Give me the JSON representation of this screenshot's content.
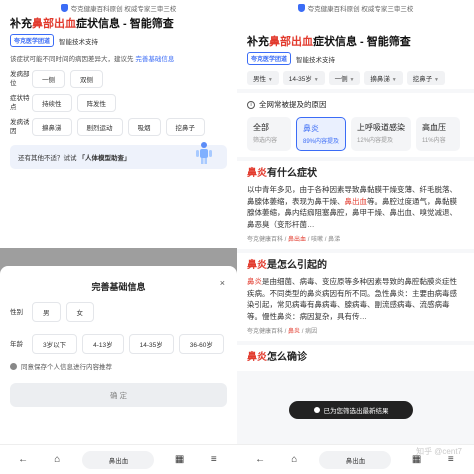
{
  "left": {
    "verify_text": "夸克健康百科原创 权威专家三审三校",
    "title_parts": [
      "补充",
      "鼻部出血",
      "症状信息 - 智能筛查"
    ],
    "brand_tag": "夸克医学团道",
    "brand_support": "智能技术支持",
    "hint_text": "该症状可能不同时间的病因差异大，建议先",
    "hint_link": "完善基础信息",
    "rows": [
      {
        "label": "发病部位",
        "options": [
          "一侧",
          "双侧"
        ]
      },
      {
        "label": "症状特点",
        "options": [
          "持续性",
          "阵发性"
        ]
      },
      {
        "label": "发病诱因",
        "options": [
          "擤鼻涕",
          "剧烈运动",
          "吸烟",
          "挖鼻子"
        ]
      }
    ],
    "ai_text": "还有其他不适？试试",
    "ai_cmd": "「人体模型助查」",
    "sheet": {
      "title": "完善基础信息",
      "close": "×",
      "gender_label": "性别",
      "gender_options": [
        "男",
        "女"
      ],
      "age_label": "年龄",
      "age_options": [
        "3岁以下",
        "4-13岁",
        "14-35岁",
        "36-60岁"
      ],
      "consent": "同意保存个人信息进行内容推荐",
      "confirm": "确 定"
    },
    "bottom": {
      "search": "鼻出血"
    }
  },
  "right": {
    "verify_text": "夸克健康百科原创 权威专家三审三校",
    "title_parts": [
      "补充",
      "鼻部出血",
      "症状信息 - 智能筛查"
    ],
    "brand_tag": "夸克医学团道",
    "brand_support": "智能技术支持",
    "filters": [
      "男性",
      "14-35岁",
      "一侧",
      "擤鼻涕",
      "挖鼻子"
    ],
    "causes_title": "全网常被提及的原因",
    "causes": [
      {
        "name": "全部",
        "pct": "筛选内容"
      },
      {
        "name": "鼻炎",
        "pct": "89%内容提及"
      },
      {
        "name": "上呼吸道感染",
        "pct": "12%内容提及"
      },
      {
        "name": "高血压",
        "pct": "11%内容"
      }
    ],
    "card1": {
      "title_red": "鼻炎",
      "title_rest": "有什么症状",
      "body_pre": "以中青年多见，由于各种因素导致鼻黏膜干燥变薄、纤毛脱落、鼻腺体萎缩，表现为鼻干燥、",
      "body_red": "鼻出血",
      "body_post": "等。鼻腔过度通气，鼻黏膜腺体萎缩，鼻内结痂阻塞鼻腔，鼻甲干燥、鼻出血、嗅觉减退、鼻恶臭（变形杆菌…",
      "source": "夸克健康百科",
      "source_tags": [
        "鼻出血"
      ],
      "source_rest": "咳嗽 / 鼻涕"
    },
    "card2": {
      "title_red": "鼻炎",
      "title_rest": "是怎么引起的",
      "body_pre": "",
      "body_red": "鼻炎",
      "body_post": "是由细菌、病毒、变应原等多种因素导致的鼻腔黏膜炎症性疾病。不同类型的鼻炎病因有所不同。急性鼻炎：主要由病毒感染引起，常见病毒有鼻病毒、腺病毒、副流感病毒、流感病毒等。慢性鼻炎：病因复杂，具有传…",
      "source": "夸克健康百科",
      "source_tags": [
        "鼻炎"
      ],
      "source_rest": "病因"
    },
    "card3": {
      "title_red": "鼻炎",
      "title_rest": "怎么确诊"
    },
    "toast": "已为您筛选出最新结果",
    "watermark": "知乎 @cent7",
    "bottom": {
      "search": "鼻出血"
    }
  }
}
